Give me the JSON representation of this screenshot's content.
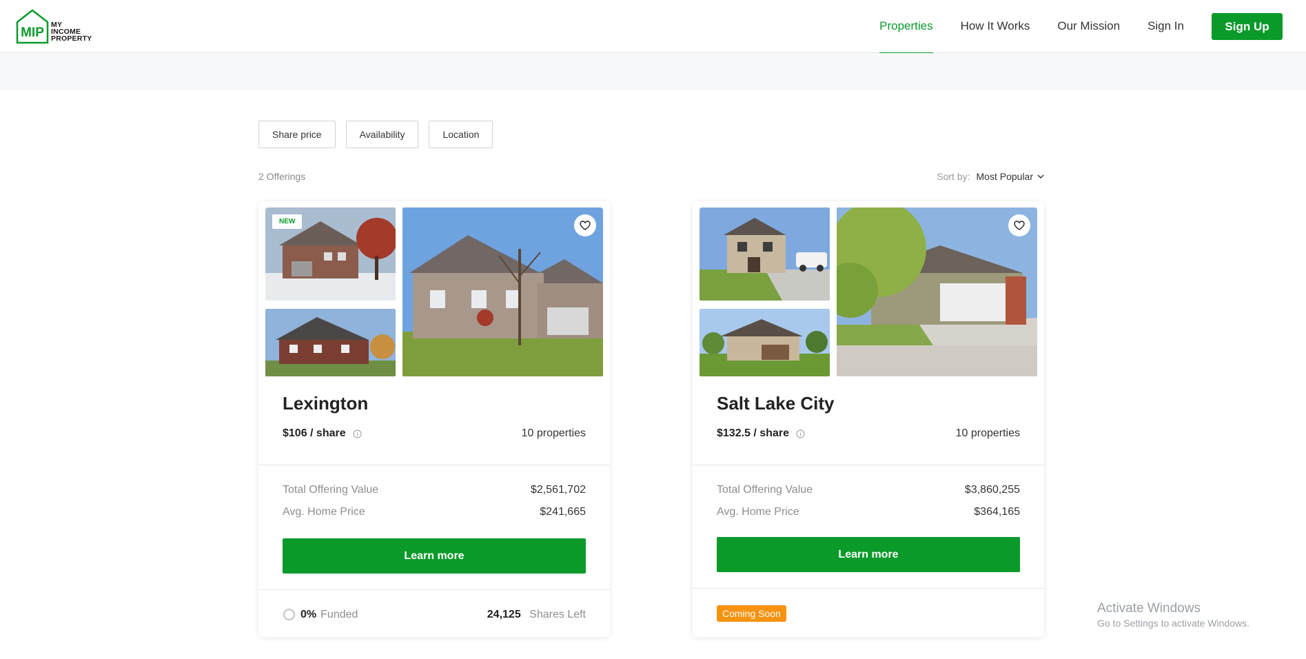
{
  "brand": {
    "logo_mark": "MIP",
    "logo_lines": [
      "MY",
      "INCOME",
      "PROPERTY"
    ],
    "accent": "#0a9a2a"
  },
  "nav": {
    "items": [
      {
        "label": "Properties",
        "active": true
      },
      {
        "label": "How It Works",
        "active": false
      },
      {
        "label": "Our Mission",
        "active": false
      },
      {
        "label": "Sign In",
        "active": false
      }
    ],
    "signup_label": "Sign Up"
  },
  "filters": [
    "Share price",
    "Availability",
    "Location"
  ],
  "results": {
    "count_label": "2 Offerings",
    "sort_label": "Sort by:",
    "sort_value": "Most Popular"
  },
  "offerings": [
    {
      "city": "Lexington",
      "badge": "NEW",
      "share_price": "$106 / share",
      "properties": "10 properties",
      "total_label": "Total Offering Value",
      "total_value": "$2,561,702",
      "avg_label": "Avg. Home Price",
      "avg_value": "$241,665",
      "cta": "Learn more",
      "funded_pct": "0%",
      "funded_label": "Funded",
      "shares_left": "24,125",
      "shares_label": "Shares Left"
    },
    {
      "city": "Salt Lake City",
      "share_price": "$132.5 / share",
      "properties": "10 properties",
      "total_label": "Total Offering Value",
      "total_value": "$3,860,255",
      "avg_label": "Avg. Home Price",
      "avg_value": "$364,165",
      "cta": "Learn more",
      "status": "Coming Soon",
      "status_color": "#f7930f"
    }
  ],
  "os_overlay": {
    "title": "Activate Windows",
    "subtitle": "Go to Settings to activate Windows."
  }
}
